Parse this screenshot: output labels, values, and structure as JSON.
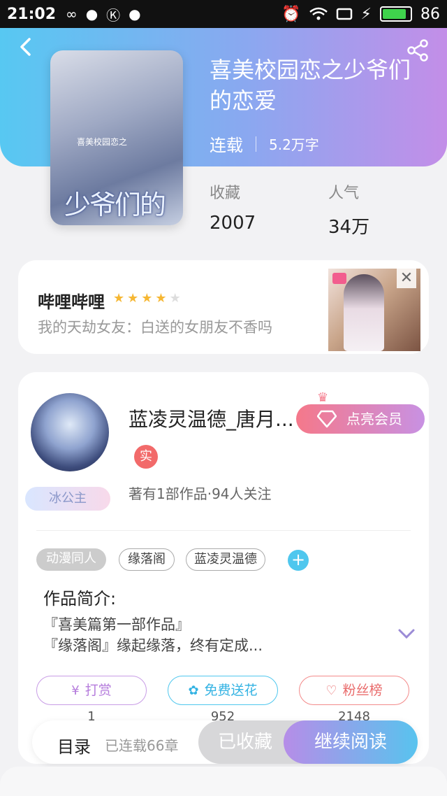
{
  "status_bar": {
    "time": "21:02",
    "battery": "86",
    "battery_level": 0.86,
    "icons": [
      "infinity-icon",
      "chat-icon",
      "k-icon",
      "chat-icon",
      "alarm-icon",
      "wifi-icon",
      "screen-icon",
      "charging-icon"
    ]
  },
  "book": {
    "title": "喜美校园恋之少爷们的恋爱",
    "status": "连载",
    "word_count": "5.2万字",
    "cover_title": "少爷们的恋爱",
    "cover_small": "喜美校园恋之",
    "stats": [
      {
        "label": "收藏",
        "value": "2007"
      },
      {
        "label": "人气",
        "value": "34万"
      }
    ]
  },
  "ad": {
    "title": "哔哩哔哩",
    "rating": 4,
    "rating_max": 5,
    "description": "我的天劫女友：白送的女朋友不香吗",
    "close": "✕"
  },
  "author": {
    "name": "蓝凌灵温德_唐月...",
    "real_badge": "实",
    "meta": "著有1部作品·94人关注",
    "medal": "冰公主",
    "vip_label": "点亮会员"
  },
  "tags": [
    "动漫同人",
    "缘落阁",
    "蓝凌灵温德"
  ],
  "tag_add": "+",
  "intro": {
    "label": "作品简介:",
    "text": "『喜美篇第一部作品』\n『缘落阁』缘起缘落，终有定成..."
  },
  "actions": [
    {
      "label": "打赏",
      "icon": "yen-coin-icon",
      "count": "1"
    },
    {
      "label": "免费送花",
      "icon": "flower-icon",
      "count": "952"
    },
    {
      "label": "粉丝榜",
      "icon": "fan-user-icon",
      "count": "2148"
    }
  ],
  "bottom_bar": {
    "toc": "目录",
    "chapters": "已连载66章",
    "collected": "已收藏",
    "read": "继续阅读"
  },
  "colors": {
    "header_gradient_start": "#57c8f2",
    "header_gradient_end": "#c38ee8",
    "accent_blue": "#4fc7ee",
    "vip_pink": "#f5788a"
  }
}
